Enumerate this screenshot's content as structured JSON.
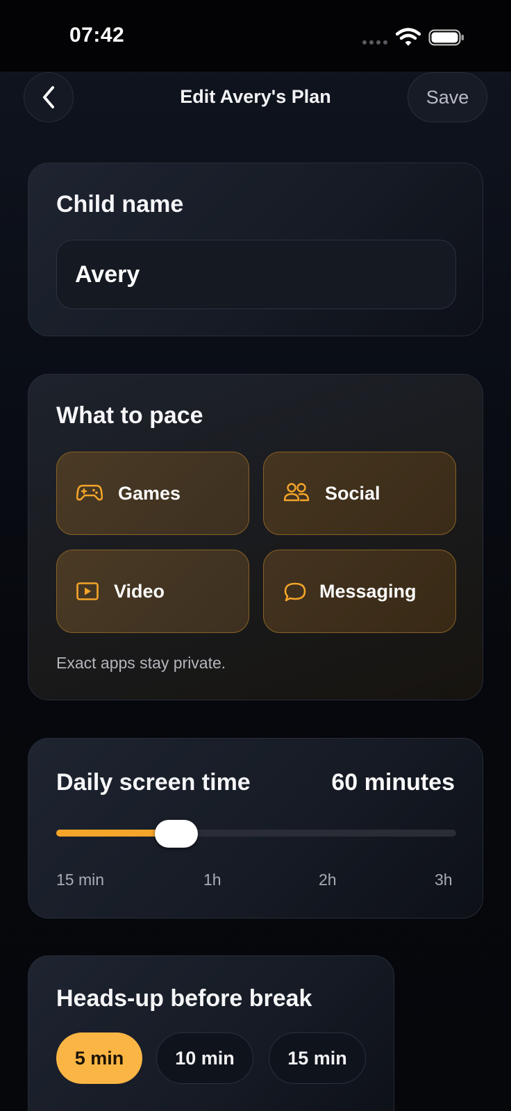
{
  "status_bar": {
    "time": "07:42"
  },
  "header": {
    "title": "Edit Avery's Plan",
    "save_label": "Save"
  },
  "child_name": {
    "title": "Child name",
    "value": "Avery"
  },
  "pace": {
    "title": "What to pace",
    "categories": [
      {
        "label": "Games",
        "icon": "gamepad-icon"
      },
      {
        "label": "Social",
        "icon": "people-icon"
      },
      {
        "label": "Video",
        "icon": "play-icon"
      },
      {
        "label": "Messaging",
        "icon": "chat-bubble-icon"
      }
    ],
    "note": "Exact apps stay private."
  },
  "screen_time": {
    "title": "Daily screen time",
    "value_label": "60 minutes",
    "value_minutes": 60,
    "min_minutes": 15,
    "max_minutes": 180,
    "ticks": [
      "15 min",
      "1h",
      "2h",
      "3h"
    ]
  },
  "heads_up": {
    "title": "Heads-up before break",
    "options": [
      "5 min",
      "10 min",
      "15 min"
    ],
    "selected": "5 min"
  },
  "colors": {
    "accent": "#f4a52a",
    "selected_chip": "#fbb545",
    "background": "#05070b"
  }
}
